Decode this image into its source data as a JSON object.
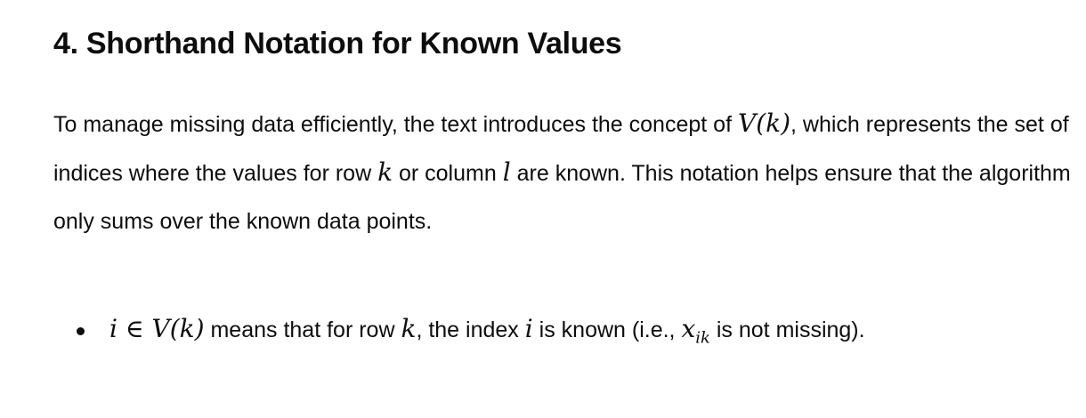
{
  "heading": "4. Shorthand Notation for Known Values",
  "para": {
    "t1": "To manage missing data efficiently, the text introduces the concept of ",
    "m1": "V(k)",
    "t2": ", which represents the set of indices where the values for row ",
    "m2": "k",
    "t3": " or column ",
    "m3": "l",
    "t4": " are known. This notation helps ensure that the algorithm only sums over the known data points."
  },
  "bullets": [
    {
      "m1": "i ∈ V(k)",
      "t1": " means that for row ",
      "m2": "k",
      "t2": ", the index ",
      "m3": "i",
      "t3": " is known (i.e., ",
      "m4": "x",
      "m4sub": "ik",
      "t4": " is not missing)."
    }
  ]
}
